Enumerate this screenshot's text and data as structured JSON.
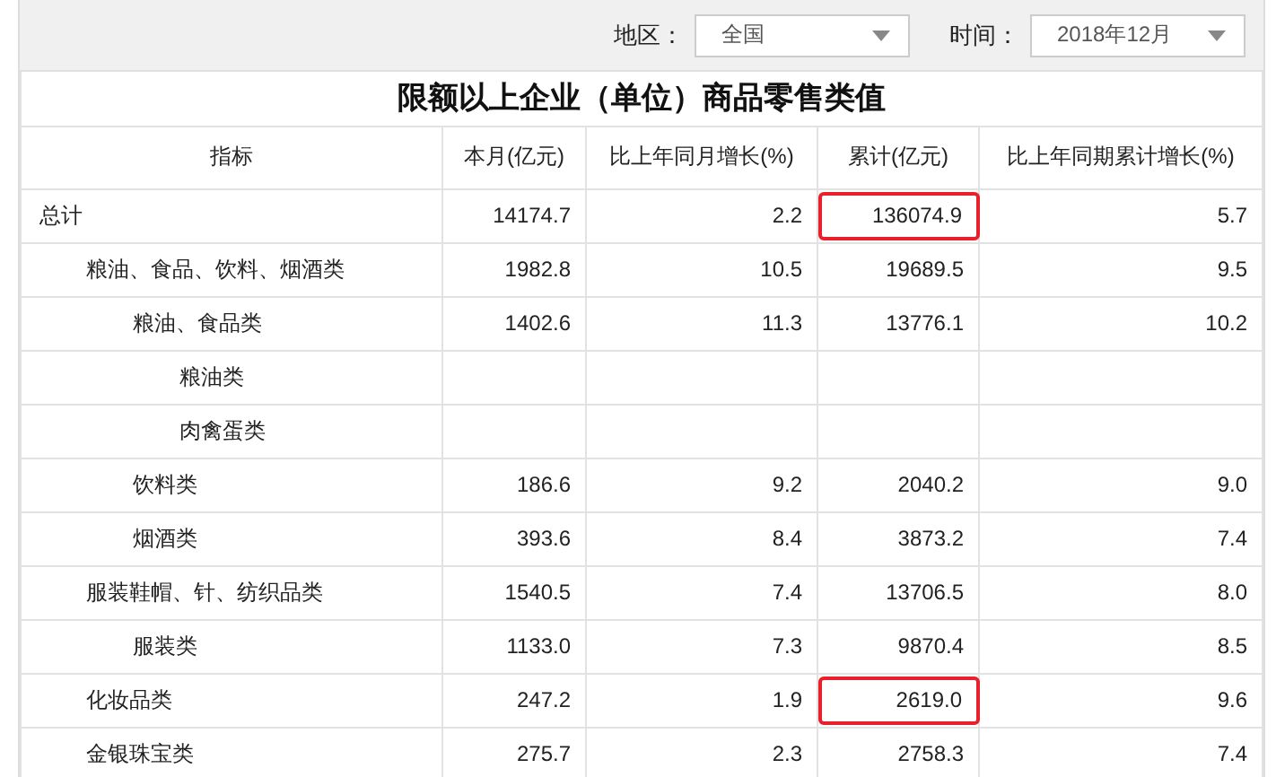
{
  "filters": [
    {
      "label": "地区：",
      "value": "全国"
    },
    {
      "label": "时间：",
      "value": "2018年12月"
    }
  ],
  "table": {
    "title": "限额以上企业（单位）商品零售类值",
    "columns": [
      "指标",
      "本月(亿元)",
      "比上年同月增长(%)",
      "累计(亿元)",
      "比上年同期累计增长(%)"
    ],
    "rows": [
      {
        "name": "总计",
        "values": [
          {
            "text": "14174.7",
            "highlighted": false
          },
          {
            "text": "2.2",
            "highlighted": false
          },
          {
            "text": "136074.9",
            "highlighted": true
          },
          {
            "text": "5.7",
            "highlighted": false
          }
        ],
        "children": [
          {
            "name": "粮油、食品、饮料、烟酒类",
            "values": [
              {
                "text": "1982.8",
                "highlighted": false
              },
              {
                "text": "10.5",
                "highlighted": false
              },
              {
                "text": "19689.5",
                "highlighted": false
              },
              {
                "text": "9.5",
                "highlighted": false
              }
            ],
            "children": [
              {
                "name": "粮油、食品类",
                "values": [
                  {
                    "text": "1402.6",
                    "highlighted": false
                  },
                  {
                    "text": "11.3",
                    "highlighted": false
                  },
                  {
                    "text": "13776.1",
                    "highlighted": false
                  },
                  {
                    "text": "10.2",
                    "highlighted": false
                  }
                ],
                "children": [
                  {
                    "name": "粮油类"
                  },
                  {
                    "name": "肉禽蛋类"
                  }
                ]
              },
              {
                "name": "饮料类",
                "values": [
                  {
                    "text": "186.6",
                    "highlighted": false
                  },
                  {
                    "text": "9.2",
                    "highlighted": false
                  },
                  {
                    "text": "2040.2",
                    "highlighted": false
                  },
                  {
                    "text": "9.0",
                    "highlighted": false
                  }
                ]
              },
              {
                "name": "烟酒类",
                "values": [
                  {
                    "text": "393.6",
                    "highlighted": false
                  },
                  {
                    "text": "8.4",
                    "highlighted": false
                  },
                  {
                    "text": "3873.2",
                    "highlighted": false
                  },
                  {
                    "text": "7.4",
                    "highlighted": false
                  }
                ]
              }
            ]
          },
          {
            "name": "服装鞋帽、针、纺织品类",
            "values": [
              {
                "text": "1540.5",
                "highlighted": false
              },
              {
                "text": "7.4",
                "highlighted": false
              },
              {
                "text": "13706.5",
                "highlighted": false
              },
              {
                "text": "8.0",
                "highlighted": false
              }
            ],
            "children": [
              {
                "name": "服装类",
                "values": [
                  {
                    "text": "1133.0",
                    "highlighted": false
                  },
                  {
                    "text": "7.3",
                    "highlighted": false
                  },
                  {
                    "text": "9870.4",
                    "highlighted": false
                  },
                  {
                    "text": "8.5",
                    "highlighted": false
                  }
                ]
              }
            ]
          },
          {
            "name": "化妆品类",
            "values": [
              {
                "text": "247.2",
                "highlighted": false
              },
              {
                "text": "1.9",
                "highlighted": false
              },
              {
                "text": "2619.0",
                "highlighted": true
              },
              {
                "text": "9.6",
                "highlighted": false
              }
            ]
          },
          {
            "name": "金银珠宝类",
            "values": [
              {
                "text": "275.7",
                "highlighted": false
              },
              {
                "text": "2.3",
                "highlighted": false
              },
              {
                "text": "2758.3",
                "highlighted": false
              },
              {
                "text": "7.4",
                "highlighted": false
              }
            ]
          }
        ]
      }
    ]
  }
}
